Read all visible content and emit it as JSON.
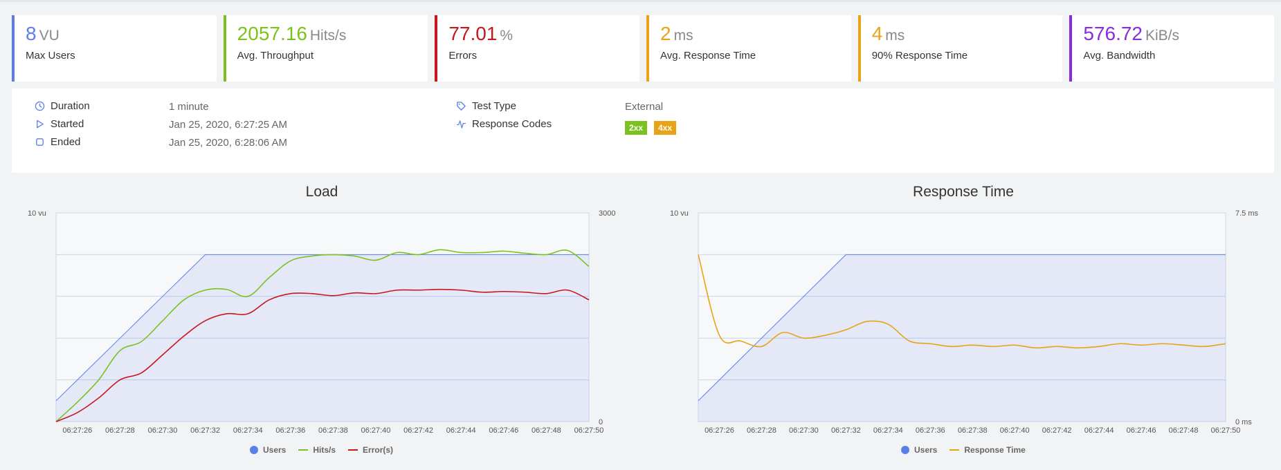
{
  "colors": {
    "users": "#5b7fe8",
    "throughput": "#7cc11f",
    "errors": "#c8161d",
    "response": "#e8a317",
    "bandwidth": "#8a2be2"
  },
  "cards": [
    {
      "value": "8",
      "unit": "VU",
      "label": "Max Users",
      "color": "#5b7fe8"
    },
    {
      "value": "2057.16",
      "unit": "Hits/s",
      "label": "Avg. Throughput",
      "color": "#7cc11f"
    },
    {
      "value": "77.01",
      "unit": "%",
      "label": "Errors",
      "color": "#c8161d"
    },
    {
      "value": "2",
      "unit": "ms",
      "label": "Avg. Response Time",
      "color": "#e8a317"
    },
    {
      "value": "4",
      "unit": "ms",
      "label": "90% Response Time",
      "color": "#e8a317"
    },
    {
      "value": "576.72",
      "unit": "KiB/s",
      "label": "Avg. Bandwidth",
      "color": "#8a2be2"
    }
  ],
  "info": {
    "duration_label": "Duration",
    "duration_value": "1 minute",
    "started_label": "Started",
    "started_value": "Jan 25, 2020, 6:27:25 AM",
    "ended_label": "Ended",
    "ended_value": "Jan 25, 2020, 6:28:06 AM",
    "test_type_label": "Test Type",
    "test_type_value": "External",
    "response_codes_label": "Response Codes",
    "response_codes": [
      {
        "code": "2xx",
        "color": "#7cc11f"
      },
      {
        "code": "4xx",
        "color": "#e8a317"
      }
    ]
  },
  "chart_data": [
    {
      "type": "line",
      "title": "Load",
      "x": [
        "06:27:25",
        "06:27:26",
        "06:27:27",
        "06:27:28",
        "06:27:29",
        "06:27:30",
        "06:27:31",
        "06:27:32",
        "06:27:33",
        "06:27:34",
        "06:27:35",
        "06:27:36",
        "06:27:37",
        "06:27:38",
        "06:27:39",
        "06:27:40",
        "06:27:41",
        "06:27:42",
        "06:27:43",
        "06:27:44",
        "06:27:45",
        "06:27:46",
        "06:27:47",
        "06:27:48",
        "06:27:49",
        "06:27:50"
      ],
      "xticks": [
        "06:27:26",
        "06:27:28",
        "06:27:30",
        "06:27:32",
        "06:27:34",
        "06:27:36",
        "06:27:38",
        "06:27:40",
        "06:27:42",
        "06:27:44",
        "06:27:46",
        "06:27:48",
        "06:27:50"
      ],
      "y_left": {
        "max_label": "10 vu",
        "min": 0,
        "max": 10
      },
      "y_right": {
        "max_label": "3000",
        "min_label": "0",
        "min": 0,
        "max": 3000
      },
      "legend": [
        "Users",
        "Hits/s",
        "Error(s)"
      ],
      "legend_position": "bottom",
      "series": [
        {
          "name": "Users",
          "axis": "left",
          "values": [
            1,
            2,
            3,
            4,
            5,
            6,
            7,
            8,
            8,
            8,
            8,
            8,
            8,
            8,
            8,
            8,
            8,
            8,
            8,
            8,
            8,
            8,
            8,
            8,
            8,
            8
          ]
        },
        {
          "name": "Hits/s",
          "axis": "right",
          "values": [
            0,
            280,
            600,
            1020,
            1150,
            1450,
            1750,
            1890,
            1900,
            1800,
            2070,
            2310,
            2380,
            2400,
            2380,
            2320,
            2430,
            2400,
            2470,
            2430,
            2430,
            2450,
            2420,
            2400,
            2460,
            2230
          ]
        },
        {
          "name": "Error(s)",
          "axis": "right",
          "values": [
            0,
            130,
            340,
            600,
            700,
            960,
            1230,
            1450,
            1550,
            1550,
            1750,
            1840,
            1840,
            1810,
            1850,
            1840,
            1890,
            1890,
            1900,
            1890,
            1860,
            1870,
            1860,
            1840,
            1890,
            1750
          ]
        }
      ]
    },
    {
      "type": "line",
      "title": "Response Time",
      "x": [
        "06:27:25",
        "06:27:26",
        "06:27:27",
        "06:27:28",
        "06:27:29",
        "06:27:30",
        "06:27:31",
        "06:27:32",
        "06:27:33",
        "06:27:34",
        "06:27:35",
        "06:27:36",
        "06:27:37",
        "06:27:38",
        "06:27:39",
        "06:27:40",
        "06:27:41",
        "06:27:42",
        "06:27:43",
        "06:27:44",
        "06:27:45",
        "06:27:46",
        "06:27:47",
        "06:27:48",
        "06:27:49",
        "06:27:50"
      ],
      "xticks": [
        "06:27:26",
        "06:27:28",
        "06:27:30",
        "06:27:32",
        "06:27:34",
        "06:27:36",
        "06:27:38",
        "06:27:40",
        "06:27:42",
        "06:27:44",
        "06:27:46",
        "06:27:48",
        "06:27:50"
      ],
      "y_left": {
        "max_label": "10 vu",
        "min": 0,
        "max": 10
      },
      "y_right": {
        "max_label": "7.5 ms",
        "min_label": "0 ms",
        "min": 0,
        "max": 7.5
      },
      "legend": [
        "Users",
        "Response Time"
      ],
      "legend_position": "bottom",
      "series": [
        {
          "name": "Users",
          "axis": "left",
          "values": [
            1,
            2,
            3,
            4,
            5,
            6,
            7,
            8,
            8,
            8,
            8,
            8,
            8,
            8,
            8,
            8,
            8,
            8,
            8,
            8,
            8,
            8,
            8,
            8,
            8,
            8
          ]
        },
        {
          "name": "Response Time",
          "axis": "right",
          "values": [
            6.0,
            3.1,
            2.9,
            2.7,
            3.2,
            3.0,
            3.1,
            3.3,
            3.6,
            3.5,
            2.9,
            2.8,
            2.7,
            2.75,
            2.7,
            2.75,
            2.65,
            2.7,
            2.65,
            2.7,
            2.8,
            2.75,
            2.8,
            2.75,
            2.7,
            2.8
          ]
        }
      ]
    }
  ]
}
